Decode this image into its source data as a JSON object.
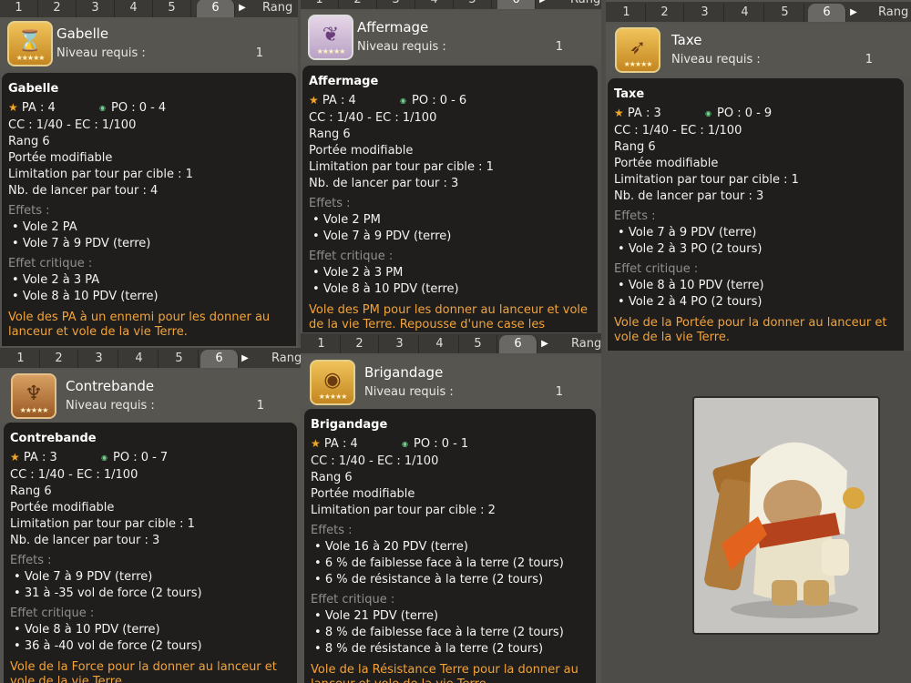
{
  "tabs": {
    "labels": [
      "1",
      "2",
      "3",
      "4",
      "5",
      "6"
    ],
    "rang": "Rang"
  },
  "level_label": "Niveau requis :",
  "panels": [
    {
      "header_title": "Gabelle",
      "level": "1",
      "icon": "hourglass-icon",
      "name": "Gabelle",
      "pa": "PA : 4",
      "po": "PO : 0 - 4",
      "stats": [
        "CC : 1/40 - EC : 1/100",
        "Rang 6",
        "Portée modifiable",
        "Limitation par tour par cible : 1",
        "Nb. de lancer par tour : 4"
      ],
      "effects_label": "Effets :",
      "effects": [
        "Vole 2 PA",
        "Vole 7 à 9 PDV (terre)"
      ],
      "crit_label": "Effet critique :",
      "crit": [
        "Vole 2 à 3 PA",
        "Vole 8 à 10 PDV (terre)"
      ],
      "desc": "Vole des PA à un ennemi pour les donner au lanceur et vole de la vie Terre."
    },
    {
      "header_title": "Affermage",
      "level": "1",
      "icon": "feather-icon",
      "name": "Affermage",
      "pa": "PA : 4",
      "po": "PO : 0 - 6",
      "stats": [
        "CC : 1/40 - EC : 1/100",
        "Rang 6",
        "Portée modifiable",
        "Limitation par tour par cible : 1",
        "Nb. de lancer par tour : 3"
      ],
      "effects_label": "Effets :",
      "effects": [
        "Vole 2 PM",
        "Vole 7 à 9 PDV (terre)"
      ],
      "crit_label": "Effet critique :",
      "crit": [
        "Vole 2 à 3 PM",
        "Vole 8 à 10 PDV (terre)"
      ],
      "desc": "Vole des PM pour les donner au lanceur et vole de la vie Terre. Repousse d'une case les ennemis au contact du lanceur."
    },
    {
      "header_title": "Taxe",
      "level": "1",
      "icon": "arrow-icon",
      "name": "Taxe",
      "pa": "PA : 3",
      "po": "PO : 0 - 9",
      "stats": [
        "CC : 1/40 - EC : 1/100",
        "Rang 6",
        "Portée modifiable",
        "Limitation par tour par cible : 1",
        "Nb. de lancer par tour : 3"
      ],
      "effects_label": "Effets :",
      "effects": [
        "Vole 7 à 9 PDV (terre)",
        "Vole 2 à 3 PO (2 tours)"
      ],
      "crit_label": "Effet critique :",
      "crit": [
        "Vole 8 à 10 PDV (terre)",
        "Vole 2 à 4 PO (2 tours)"
      ],
      "desc": "Vole de la Portée pour la donner au lanceur et vole de la vie Terre."
    },
    {
      "header_title": "Contrebande",
      "level": "1",
      "icon": "claw-icon",
      "name": "Contrebande",
      "pa": "PA : 3",
      "po": "PO : 0 - 7",
      "stats": [
        "CC : 1/40 - EC : 1/100",
        "Rang 6",
        "Portée modifiable",
        "Limitation par tour par cible : 1",
        "Nb. de lancer par tour : 3"
      ],
      "effects_label": "Effets :",
      "effects": [
        "Vole 7 à 9 PDV (terre)",
        "31 à -35 vol de force (2 tours)"
      ],
      "crit_label": "Effet critique :",
      "crit": [
        "Vole 8 à 10 PDV (terre)",
        "36 à -40 vol de force (2 tours)"
      ],
      "desc": "Vole de la Force pour la donner au lanceur et vole de la vie Terre."
    },
    {
      "header_title": "Brigandage",
      "level": "1",
      "icon": "eye-icon",
      "name": "Brigandage",
      "pa": "PA : 4",
      "po": "PO : 0 - 1",
      "stats": [
        "CC : 1/40 - EC : 1/100",
        "Rang 6",
        "Portée modifiable",
        "Limitation par tour par cible : 2"
      ],
      "effects_label": "Effets :",
      "effects": [
        "Vole 16 à 20 PDV (terre)",
        "6 % de faiblesse face à la terre (2 tours)",
        "6 % de résistance à la terre (2 tours)"
      ],
      "crit_label": "Effet critique :",
      "crit": [
        "Vole 21 PDV (terre)",
        "8 % de faiblesse face à la terre (2 tours)",
        "8 % de résistance à la terre (2 tours)"
      ],
      "desc": "Vole de la Résistance Terre pour la donner au lanceur et vole de la vie Terre."
    }
  ],
  "illustration": "character-illustration"
}
